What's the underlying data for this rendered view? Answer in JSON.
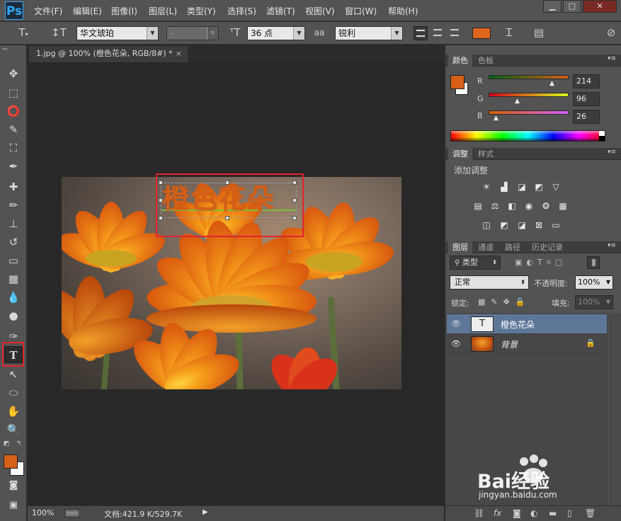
{
  "app": {
    "logo": "Ps"
  },
  "menu": [
    "文件(F)",
    "编辑(E)",
    "图像(I)",
    "图层(L)",
    "类型(Y)",
    "选择(S)",
    "滤镜(T)",
    "视图(V)",
    "窗口(W)",
    "帮助(H)"
  ],
  "window_controls": {
    "minimize": "▁",
    "maximize": "□",
    "close": "✕"
  },
  "options": {
    "font_family": "华文琥珀",
    "font_style": "-",
    "font_size": "36 点",
    "aa_label": "aa",
    "antialias": "锐利",
    "text_color": "#e0661e"
  },
  "document": {
    "tab_title": "1.jpg @ 100% (橙色花朵, RGB/8#) *",
    "tab_close": "×",
    "canvas_text": "橙色花朵",
    "text_color": "#d66018"
  },
  "status": {
    "zoom": "100%",
    "doc_size": "文档:421.9 K/529.7K"
  },
  "color_panel": {
    "tabs": [
      "颜色",
      "色板"
    ],
    "foreground": "#d66018",
    "background": "#ffffff",
    "r_label": "R",
    "r_value": "214",
    "r_level": 0.84,
    "g_label": "G",
    "g_value": "96",
    "g_level": 0.38,
    "b_label": "B",
    "b_value": "26",
    "b_level": 0.1
  },
  "adjust_panel": {
    "tabs": [
      "调整",
      "样式"
    ],
    "add_label": "添加调整"
  },
  "layers_panel": {
    "tabs": [
      "图层",
      "通道",
      "路径",
      "历史记录"
    ],
    "filter": "类型",
    "blend_mode": "正常",
    "opacity_label": "不透明度:",
    "opacity": "100%",
    "lock_label": "锁定:",
    "fill_label": "填充:",
    "fill": "100%",
    "layers": [
      {
        "name": "橙色花朵",
        "thumb": "T",
        "selected": true
      },
      {
        "name": "背景",
        "selected": false
      }
    ]
  },
  "watermark": {
    "brand": "Bai经验",
    "url": "jingyan.baidu.com"
  }
}
